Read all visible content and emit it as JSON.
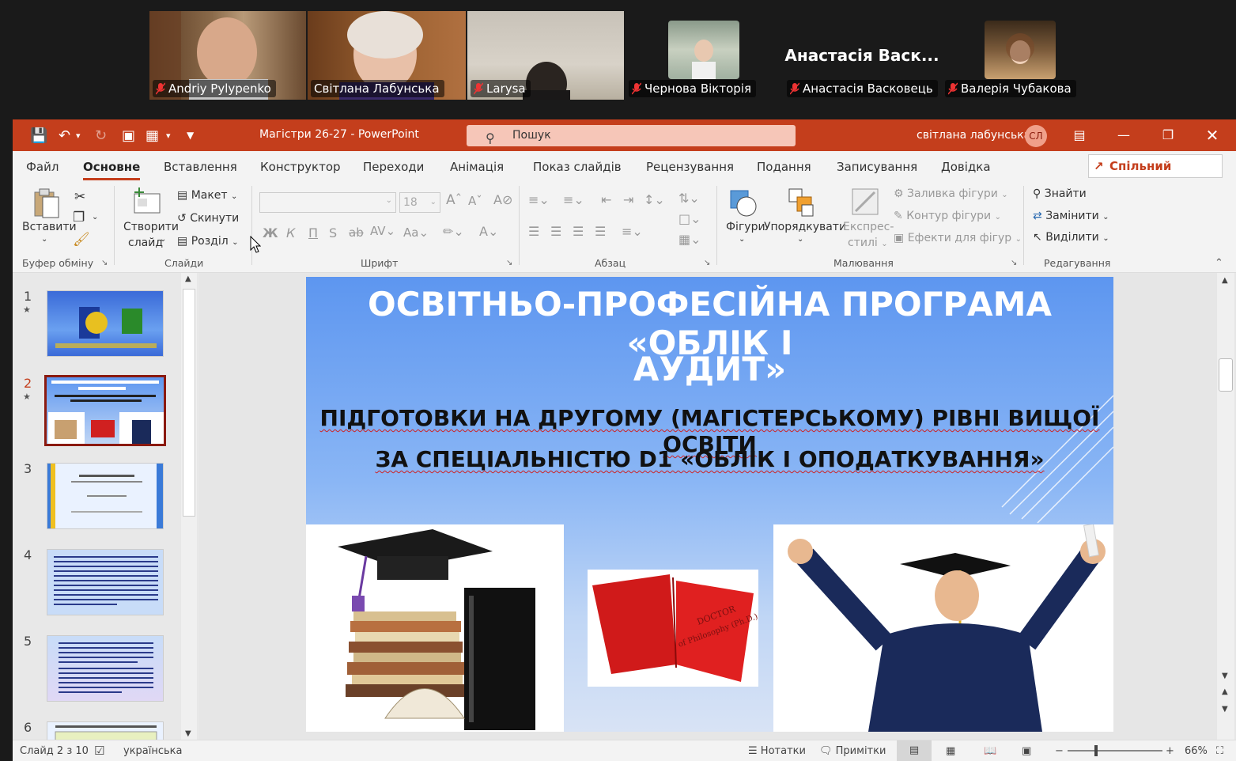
{
  "participants": [
    {
      "name": "Andriy Pylypenko",
      "mic": "muted"
    },
    {
      "name": "Світлана Лабунська",
      "mic": "on",
      "active": true
    },
    {
      "name": "Larysa",
      "mic": "muted"
    },
    {
      "name": "Чернова Вікторія",
      "mic": "muted"
    },
    {
      "name": "Анастасія Васковець",
      "mic": "muted",
      "display": "Анастасія Васк..."
    },
    {
      "name": "Валерія Чубакова",
      "mic": "muted"
    }
  ],
  "titlebar": {
    "doc_title": "Магістри 26-27  -  PowerPoint",
    "search_placeholder": "Пошук",
    "user_name": "світлана лабунська",
    "user_initials": "СЛ"
  },
  "tabs": [
    "Файл",
    "Основне",
    "Вставлення",
    "Конструктор",
    "Переходи",
    "Анімація",
    "Показ слайдів",
    "Рецензування",
    "Подання",
    "Записування",
    "Довідка"
  ],
  "active_tab": "Основне",
  "share_label": "Спільний доступ",
  "ribbon": {
    "paste": "Вставити",
    "new_slide_1": "Створити",
    "new_slide_2": "слайд",
    "layout": "Макет",
    "reset": "Скинути",
    "section": "Розділ",
    "font_size": "18",
    "shapes": "Фігури",
    "arrange": "Упорядкувати",
    "quick_styles_1": "Експрес-",
    "quick_styles_2": "стилі",
    "shape_fill": "Заливка фігури",
    "shape_outline": "Контур фігури",
    "shape_effects": "Ефекти для фігур",
    "find": "Знайти",
    "replace": "Замінити",
    "select": "Виділити",
    "groups": {
      "clipboard": "Буфер обміну",
      "slides": "Слайди",
      "font": "Шрифт",
      "paragraph": "Абзац",
      "drawing": "Малювання",
      "editing": "Редагування"
    }
  },
  "thumbnails": [
    {
      "num": "1",
      "star": true
    },
    {
      "num": "2",
      "star": true,
      "selected": true
    },
    {
      "num": "3",
      "star": false
    },
    {
      "num": "4",
      "star": false
    },
    {
      "num": "5",
      "star": false
    },
    {
      "num": "6",
      "star": false
    }
  ],
  "slide": {
    "title_line1": "ОСВІТНЬО-ПРОФЕСІЙНА ПРОГРАМА «ОБЛІК І",
    "title_line2": "АУДИТ»",
    "subtitle_line1": "ПІДГОТОВКИ НА ДРУГОМУ (МАГІСТЕРСЬКОМУ) РІВНІ ВИЩОЇ ОСВІТИ",
    "subtitle_line2": "ЗА СПЕЦІАЛЬНІСТЮ D1 «ОБЛІК І ОПОДАТКУВАННЯ»",
    "book_text_1": "DOCTOR",
    "book_text_2": "of Philosophy (Ph.D.)"
  },
  "status": {
    "slide_counter": "Слайд 2 з 10",
    "language": "українська",
    "notes": "Нотатки",
    "comments": "Примітки",
    "zoom": "66%"
  },
  "colors": {
    "accent": "#c43e1c",
    "active_speaker": "#22c55e"
  }
}
